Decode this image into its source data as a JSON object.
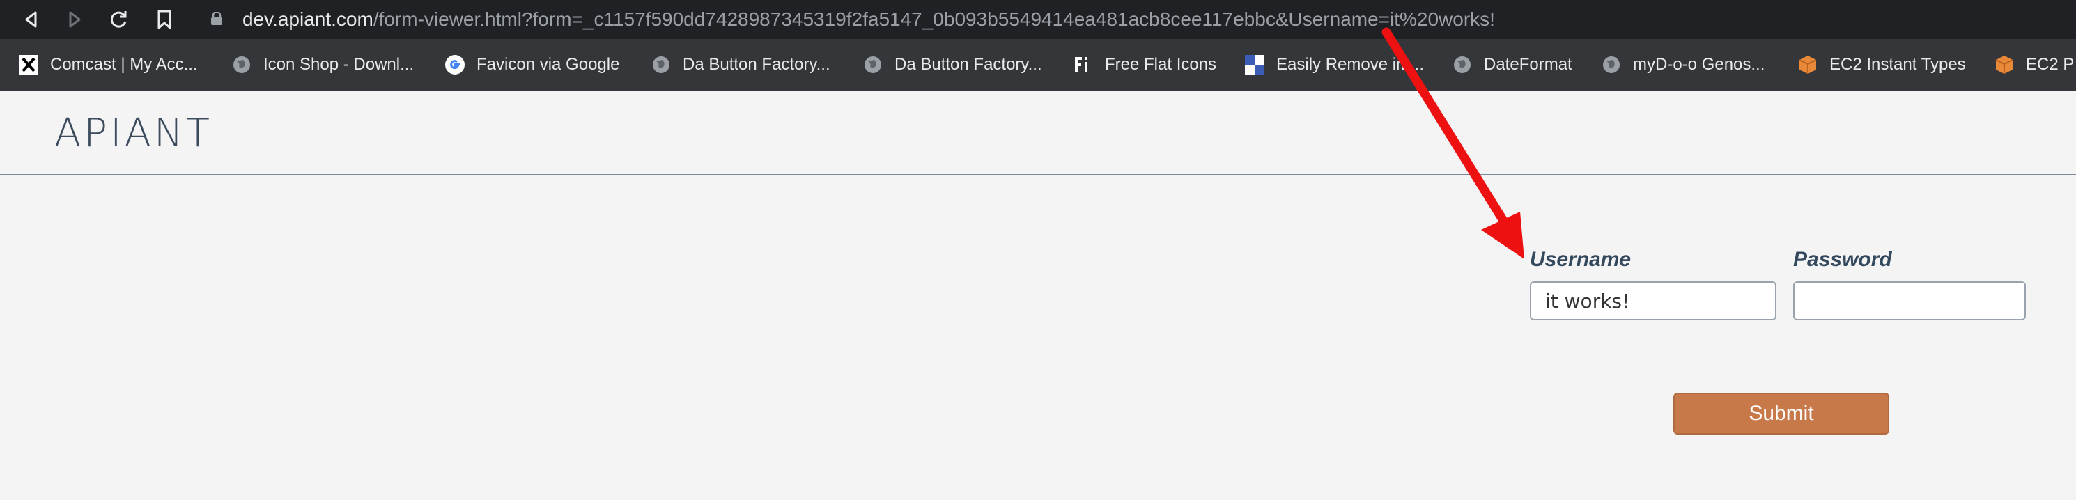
{
  "browser": {
    "url_host": "dev.apiant.com",
    "url_rest": "/form-viewer.html?form=_c1157f590dd7428987345319f2fa5147_0b093b5549414ea481acb8cee117ebbc&Username=it%20works!",
    "bookmarks": [
      {
        "label": "Comcast | My Acc...",
        "icon": "x-logo-icon"
      },
      {
        "label": "Icon Shop - Downl...",
        "icon": "globe-icon"
      },
      {
        "label": "Favicon via Google",
        "icon": "google-icon"
      },
      {
        "label": "Da Button Factory...",
        "icon": "globe-icon"
      },
      {
        "label": "Da Button Factory...",
        "icon": "globe-icon"
      },
      {
        "label": "Free Flat Icons",
        "icon": "fi-logo-icon"
      },
      {
        "label": "Easily Remove im...",
        "icon": "checker-icon"
      },
      {
        "label": "DateFormat",
        "icon": "globe-icon"
      },
      {
        "label": "myD-o-o Genos...",
        "icon": "globe-icon"
      },
      {
        "label": "EC2 Instant Types",
        "icon": "aws-cube-icon"
      },
      {
        "label": "EC2 P",
        "icon": "aws-cube-icon"
      }
    ]
  },
  "page": {
    "logo": "APIANT",
    "form": {
      "username_label": "Username",
      "username_value": "it works!",
      "password_label": "Password",
      "password_value": "",
      "submit_label": "Submit"
    }
  },
  "colors": {
    "accent": "#c8794a",
    "label": "#34495e",
    "arrow": "#ee1111"
  }
}
